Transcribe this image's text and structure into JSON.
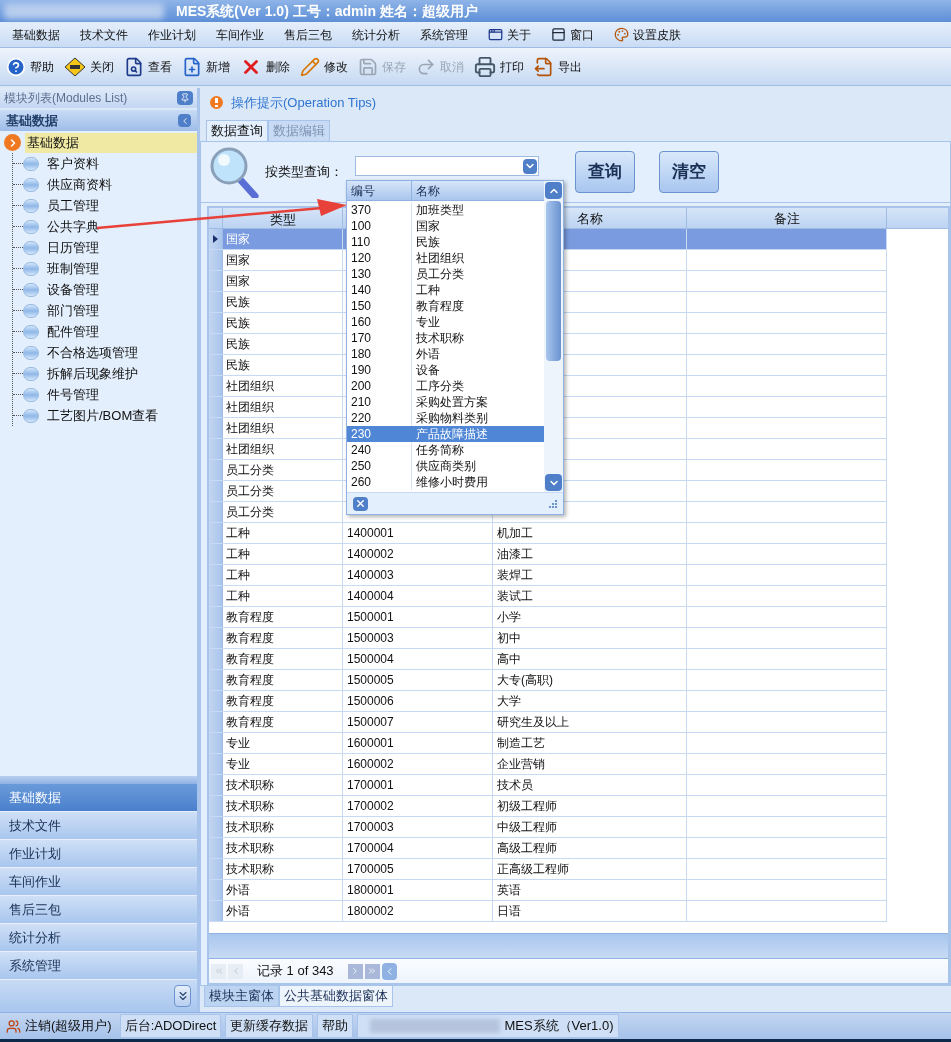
{
  "window": {
    "title": "MES系统(Ver 1.0) 工号：admin  姓名：超级用户"
  },
  "menu": [
    {
      "label": "基础数据",
      "kind": "plain"
    },
    {
      "label": "技术文件",
      "kind": "plain"
    },
    {
      "label": "作业计划",
      "kind": "plain"
    },
    {
      "label": "车间作业",
      "kind": "plain"
    },
    {
      "label": "售后三包",
      "kind": "plain"
    },
    {
      "label": "统计分析",
      "kind": "plain"
    },
    {
      "label": "系统管理",
      "kind": "plain"
    },
    {
      "label": "关于",
      "kind": "about"
    },
    {
      "label": "窗口",
      "kind": "window"
    },
    {
      "label": "设置皮肤",
      "kind": "skin"
    }
  ],
  "toolbar": [
    {
      "label": "帮助",
      "disabled": false
    },
    {
      "label": "关闭",
      "disabled": false
    },
    {
      "label": "查看",
      "disabled": false
    },
    {
      "label": "新增",
      "disabled": false
    },
    {
      "label": "删除",
      "disabled": false
    },
    {
      "label": "修改",
      "disabled": false
    },
    {
      "label": "保存",
      "disabled": true
    },
    {
      "label": "取消",
      "disabled": true
    },
    {
      "label": "打印",
      "disabled": false
    },
    {
      "label": "导出",
      "disabled": false
    }
  ],
  "modules_panel": {
    "title": "模块列表(Modules List)",
    "group": "基础数据",
    "tree": {
      "label": "基础数据",
      "selected": true,
      "expanded": true,
      "children": [
        {
          "label": "客户资料",
          "selected": false
        },
        {
          "label": "供应商资料",
          "selected": false
        },
        {
          "label": "员工管理",
          "selected": false
        },
        {
          "label": "公共字典",
          "selected": false
        },
        {
          "label": "日历管理",
          "selected": false
        },
        {
          "label": "班制管理",
          "selected": false
        },
        {
          "label": "设备管理",
          "selected": false
        },
        {
          "label": "部门管理",
          "selected": false
        },
        {
          "label": "配件管理",
          "selected": false
        },
        {
          "label": "不合格选项管理",
          "selected": false
        },
        {
          "label": "拆解后现象维护",
          "selected": false
        },
        {
          "label": "件号管理",
          "selected": false
        },
        {
          "label": "工艺图片/BOM查看",
          "selected": false
        }
      ]
    }
  },
  "nav_buttons": [
    {
      "label": "基础数据",
      "selected": true
    },
    {
      "label": "技术文件",
      "selected": false
    },
    {
      "label": "作业计划",
      "selected": false
    },
    {
      "label": "车间作业",
      "selected": false
    },
    {
      "label": "售后三包",
      "selected": false
    },
    {
      "label": "统计分析",
      "selected": false
    },
    {
      "label": "系统管理",
      "selected": false
    }
  ],
  "tips": "操作提示(Operation Tips)",
  "tabs": [
    {
      "label": "数据查询",
      "selected": true,
      "disabled": false
    },
    {
      "label": "数据编辑",
      "selected": false,
      "disabled": true
    }
  ],
  "search": {
    "label": "按类型查询：",
    "buttons": [
      "查询",
      "清空"
    ]
  },
  "dropdown": {
    "columns": [
      "编号",
      "名称"
    ],
    "items": [
      {
        "code": "370",
        "name": "加班类型",
        "selected": false
      },
      {
        "code": "100",
        "name": "国家",
        "selected": false
      },
      {
        "code": "110",
        "name": "民族",
        "selected": false
      },
      {
        "code": "120",
        "name": "社团组织",
        "selected": false
      },
      {
        "code": "130",
        "name": "员工分类",
        "selected": false
      },
      {
        "code": "140",
        "name": "工种",
        "selected": false
      },
      {
        "code": "150",
        "name": "教育程度",
        "selected": false
      },
      {
        "code": "160",
        "name": "专业",
        "selected": false
      },
      {
        "code": "170",
        "name": "技术职称",
        "selected": false
      },
      {
        "code": "180",
        "name": "外语",
        "selected": false
      },
      {
        "code": "190",
        "name": "设备",
        "selected": false
      },
      {
        "code": "200",
        "name": "工序分类",
        "selected": false
      },
      {
        "code": "210",
        "name": "采购处置方案",
        "selected": false
      },
      {
        "code": "220",
        "name": "采购物料类别",
        "selected": false
      },
      {
        "code": "230",
        "name": "产品故障描述",
        "selected": true
      },
      {
        "code": "240",
        "name": "任务简称",
        "selected": false
      },
      {
        "code": "250",
        "name": "供应商类别",
        "selected": false
      },
      {
        "code": "260",
        "name": "维修小时费用",
        "selected": false
      }
    ]
  },
  "table": {
    "columns": [
      "类型",
      "名称",
      "备注"
    ],
    "rows": [
      {
        "type": "国家",
        "selected": true
      },
      {
        "type": "国家",
        "selected": false
      },
      {
        "type": "国家",
        "selected": false
      },
      {
        "type": "民族",
        "selected": false
      },
      {
        "type": "民族",
        "selected": false
      },
      {
        "type": "民族",
        "selected": false
      },
      {
        "type": "民族",
        "selected": false
      },
      {
        "type": "社团组织",
        "selected": false
      },
      {
        "type": "社团组织",
        "selected": false
      },
      {
        "type": "社团组织",
        "selected": false
      },
      {
        "type": "社团组织",
        "selected": false
      },
      {
        "type": "员工分类",
        "selected": false
      },
      {
        "type": "员工分类",
        "selected": false
      },
      {
        "type": "员工分类",
        "selected": false
      },
      {
        "type": "工种",
        "code": "1400001",
        "name": "机加工",
        "selected": false
      },
      {
        "type": "工种",
        "code": "1400002",
        "name": "油漆工",
        "selected": false
      },
      {
        "type": "工种",
        "code": "1400003",
        "name": "装焊工",
        "selected": false
      },
      {
        "type": "工种",
        "code": "1400004",
        "name": "装试工",
        "selected": false
      },
      {
        "type": "教育程度",
        "code": "1500001",
        "name": "小学",
        "selected": false
      },
      {
        "type": "教育程度",
        "code": "1500003",
        "name": "初中",
        "selected": false
      },
      {
        "type": "教育程度",
        "code": "1500004",
        "name": "高中",
        "selected": false
      },
      {
        "type": "教育程度",
        "code": "1500005",
        "name": "大专(高职)",
        "selected": false
      },
      {
        "type": "教育程度",
        "code": "1500006",
        "name": "大学",
        "selected": false
      },
      {
        "type": "教育程度",
        "code": "1500007",
        "name": "研究生及以上",
        "selected": false
      },
      {
        "type": "专业",
        "code": "1600001",
        "name": "制造工艺",
        "selected": false
      },
      {
        "type": "专业",
        "code": "1600002",
        "name": "企业营销",
        "selected": false
      },
      {
        "type": "技术职称",
        "code": "1700001",
        "name": "技术员",
        "selected": false
      },
      {
        "type": "技术职称",
        "code": "1700002",
        "name": "初级工程师",
        "selected": false
      },
      {
        "type": "技术职称",
        "code": "1700003",
        "name": "中级工程师",
        "selected": false
      },
      {
        "type": "技术职称",
        "code": "1700004",
        "name": "高级工程师",
        "selected": false
      },
      {
        "type": "技术职称",
        "code": "1700005",
        "name": "正高级工程师",
        "selected": false
      },
      {
        "type": "外语",
        "code": "1800001",
        "name": "英语",
        "selected": false
      },
      {
        "type": "外语",
        "code": "1800002",
        "name": "日语",
        "selected": false
      }
    ]
  },
  "navigator": {
    "text": "记录 1 of 343"
  },
  "doc_tabs": [
    {
      "label": "模块主窗体",
      "selected": false
    },
    {
      "label": "公共基础数据窗体",
      "selected": true
    }
  ],
  "status_bar": [
    {
      "label": "注销(超级用户)",
      "kind": "user"
    },
    {
      "label": "后台:ADODirect",
      "kind": "plain"
    },
    {
      "label": "更新缓存数据",
      "kind": "plain"
    },
    {
      "label": "帮助",
      "kind": "plain"
    },
    {
      "label": "MES系统（Ver1.0)",
      "kind": "product"
    }
  ]
}
